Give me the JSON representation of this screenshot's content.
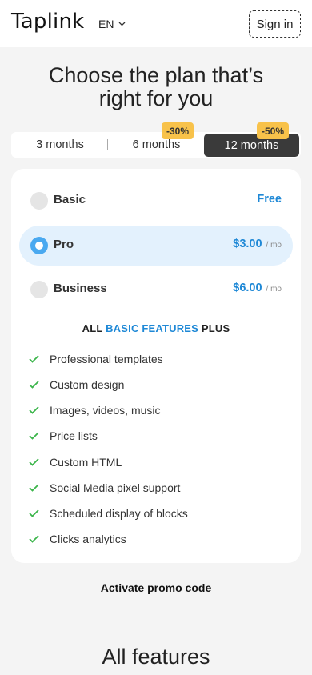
{
  "header": {
    "logo": "Taplink",
    "language": "EN",
    "signin_label": "Sign in"
  },
  "headline": {
    "line1": "Choose the plan that’s",
    "line2": "right for you"
  },
  "billing_tabs": [
    {
      "label": "3 months",
      "badge": ""
    },
    {
      "label": "6 months",
      "badge": "-30%"
    },
    {
      "label": "12 months",
      "badge": "-50%",
      "selected": true
    }
  ],
  "plans": [
    {
      "name": "Basic",
      "price": "Free",
      "per": ""
    },
    {
      "name": "Pro",
      "price": "$3.00",
      "per": "/ mo",
      "selected": true
    },
    {
      "name": "Business",
      "price": "$6.00",
      "per": "/ mo"
    }
  ],
  "features_heading": {
    "pre": "ALL",
    "highlight": "BASIC FEATURES",
    "post": "PLUS"
  },
  "features": [
    "Professional templates",
    "Custom design",
    "Images, videos, music",
    "Price lists",
    "Custom HTML",
    "Social Media pixel support",
    "Scheduled display of blocks",
    "Clicks analytics"
  ],
  "promo_label": "Activate promo code",
  "all_features_heading": "All features",
  "colors": {
    "accent": "#1e88d6",
    "selected_plan_bg": "#e3f1fd",
    "badge": "#f8c24a",
    "check": "#3bb54a",
    "active_tab": "#3a3a3a"
  }
}
